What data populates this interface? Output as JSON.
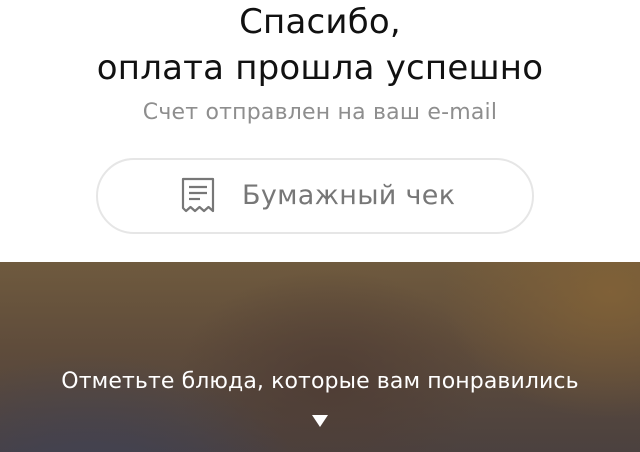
{
  "header": {
    "title_line1": "Спасибо,",
    "title_line2": "оплата прошла успешно",
    "subtitle": "Счет отправлен на ваш e-mail"
  },
  "receipt_button": {
    "label": "Бумажный чек",
    "icon": "receipt-icon"
  },
  "rating_section": {
    "prompt": "Отметьте блюда, которые вам понравились",
    "expand_icon": "triangle-down-icon"
  },
  "colors": {
    "background": "#ffffff",
    "title": "#111111",
    "subtitle": "#8e8e8e",
    "button_border": "#e6e6e6",
    "button_text": "#777777",
    "bottom_text": "#ffffff"
  }
}
